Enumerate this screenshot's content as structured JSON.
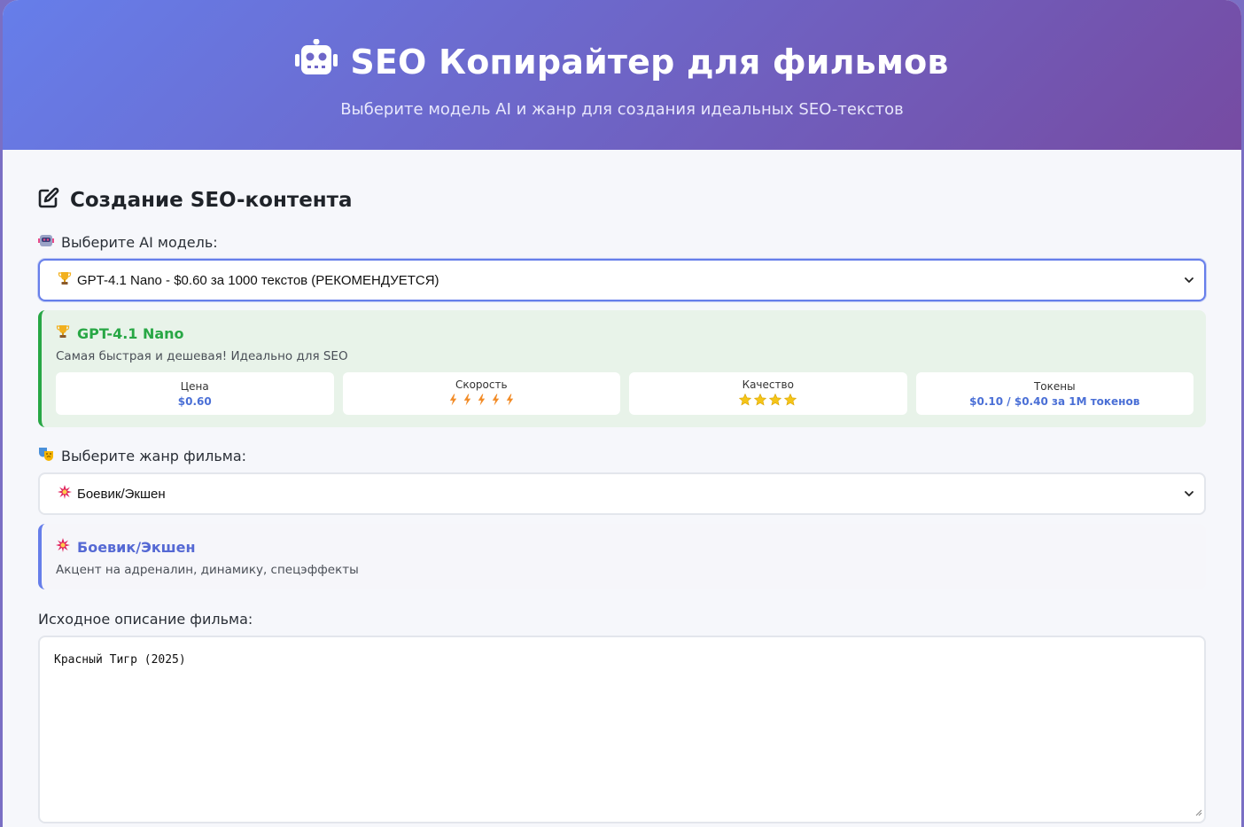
{
  "header": {
    "title": "SEO Копирайтер для фильмов",
    "subtitle": "Выберите модель AI и жанр для создания идеальных SEO-текстов"
  },
  "form": {
    "section_title": "Создание SEO-контента",
    "model_label": "Выберите AI модель:",
    "model_selected": "GPT-4.1 Nano - $0.60 за 1000 текстов (РЕКОМЕНДУЕТСЯ)",
    "model_info": {
      "title": "GPT-4.1 Nano",
      "description": "Самая быстрая и дешевая! Идеально для SEO",
      "price_label": "Цена",
      "price_value": "$0.60",
      "speed_label": "Скорость",
      "speed_rating": 5,
      "quality_label": "Качество",
      "quality_rating": 4,
      "tokens_label": "Токены",
      "tokens_value": "$0.10 / $0.40 за 1M токенов"
    },
    "genre_label": "Выберите жанр фильма:",
    "genre_selected": "Боевик/Экшен",
    "genre_info": {
      "title": "Боевик/Экшен",
      "description": "Акцент на адреналин, динамику, спецэффекты"
    },
    "description_label": "Исходное описание фильма:",
    "description_value": "Красный Тигр (2025)"
  },
  "colors": {
    "header_gradient_start": "#667eea",
    "header_gradient_end": "#764ba2",
    "recommended_green": "#28a745",
    "accent_blue": "#667eea"
  }
}
